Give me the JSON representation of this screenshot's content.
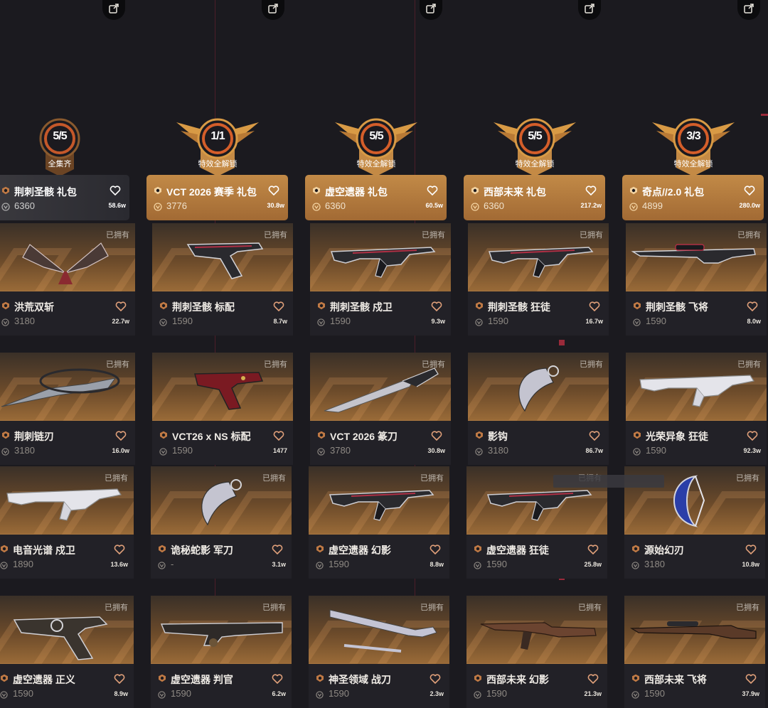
{
  "colors": {
    "background": "#1b1a1f",
    "accent_gold": "#c28a47",
    "card_info": "#222127"
  },
  "share_icon": "share-icon",
  "packs": [
    {
      "badge_count": "5/5",
      "badge_label": "全集齐",
      "name": "荆刺圣骸 礼包",
      "price": "6360",
      "favorites": "58.6w"
    },
    {
      "badge_count": "1/1",
      "badge_label": "特效全解锁",
      "name": "VCT 2026 赛季 礼包",
      "price": "3776",
      "favorites": "30.8w"
    },
    {
      "badge_count": "5/5",
      "badge_label": "特效全解锁",
      "name": "虚空遗器 礼包",
      "price": "6360",
      "favorites": "60.5w"
    },
    {
      "badge_count": "5/5",
      "badge_label": "特效全解锁",
      "name": "西部未来 礼包",
      "price": "6360",
      "favorites": "217.2w"
    },
    {
      "badge_count": "3/3",
      "badge_label": "特效全解锁",
      "name": "奇点//2.0 礼包",
      "price": "4899",
      "favorites": "280.0w"
    }
  ],
  "owned_label": "已拥有",
  "rows": [
    [
      {
        "name": "洪荒双斩",
        "price": "3180",
        "favorites": "22.7w",
        "weapon": "melee-wings"
      },
      {
        "name": "荆刺圣骸 标配",
        "price": "1590",
        "favorites": "8.7w",
        "weapon": "pistol"
      },
      {
        "name": "荆刺圣骸 戍卫",
        "price": "1590",
        "favorites": "9.3w",
        "weapon": "rifle"
      },
      {
        "name": "荆刺圣骸 狂徒",
        "price": "1590",
        "favorites": "16.7w",
        "weapon": "rifle"
      },
      {
        "name": "荆刺圣骸 飞将",
        "price": "1590",
        "favorites": "8.0w",
        "weapon": "sniper"
      }
    ],
    [
      {
        "name": "荆刺链刃",
        "price": "3180",
        "favorites": "16.0w",
        "weapon": "melee-blade"
      },
      {
        "name": "VCT26 x NS 标配",
        "price": "1590",
        "favorites": "1477",
        "weapon": "pistol-red"
      },
      {
        "name": "VCT 2026 篆刀",
        "price": "3780",
        "favorites": "30.8w",
        "weapon": "knife"
      },
      {
        "name": "影钩",
        "price": "3180",
        "favorites": "86.7w",
        "weapon": "karambit"
      },
      {
        "name": "光荣异象 狂徒",
        "price": "1590",
        "favorites": "92.3w",
        "weapon": "rifle-white"
      }
    ],
    [
      {
        "name": "电音光谱 戍卫",
        "price": "1890",
        "favorites": "13.6w",
        "weapon": "rifle-white"
      },
      {
        "name": "诡秘蛇影 军刀",
        "price": "-",
        "favorites": "3.1w",
        "weapon": "karambit"
      },
      {
        "name": "虚空遗器 幻影",
        "price": "1590",
        "favorites": "8.8w",
        "weapon": "rifle"
      },
      {
        "name": "虚空遗器 狂徒",
        "price": "1590",
        "favorites": "25.8w",
        "weapon": "rifle"
      },
      {
        "name": "源始幻刃",
        "price": "3180",
        "favorites": "10.8w",
        "weapon": "crescent"
      }
    ],
    [
      {
        "name": "虚空遗器 正义",
        "price": "1590",
        "favorites": "8.9w",
        "weapon": "pistol-big"
      },
      {
        "name": "虚空遗器 判官",
        "price": "1590",
        "favorites": "6.2w",
        "weapon": "shotgun"
      },
      {
        "name": "神圣领域 战刀",
        "price": "1590",
        "favorites": "2.3w",
        "weapon": "sword"
      },
      {
        "name": "西部未来 幻影",
        "price": "1590",
        "favorites": "21.3w",
        "weapon": "rifle-wood"
      },
      {
        "name": "西部未来 飞将",
        "price": "1590",
        "favorites": "37.9w",
        "weapon": "sniper-wood"
      }
    ]
  ]
}
